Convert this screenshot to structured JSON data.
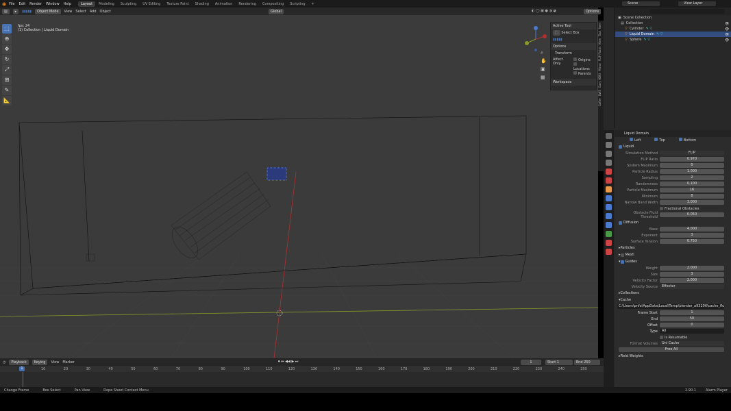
{
  "menu": [
    "File",
    "Edit",
    "Render",
    "Window",
    "Help"
  ],
  "workspaces": [
    "Layout",
    "Modeling",
    "Sculpting",
    "UV Editing",
    "Texture Paint",
    "Shading",
    "Animation",
    "Rendering",
    "Compositing",
    "Scripting",
    "+"
  ],
  "active_workspace": "Layout",
  "scene": "Scene",
  "view_layer": "View Layer",
  "viewport": {
    "mode": "Object Mode",
    "menus": [
      "View",
      "Select",
      "Add",
      "Object"
    ],
    "orientation": "Global",
    "options_label": "Options",
    "fps": "fps: 24",
    "context": "(1) Collection | Liquid Domain"
  },
  "npanel": {
    "active_tool": "Active Tool",
    "select_box": "Select Box",
    "options": "Options",
    "transform": "Transform",
    "affect_only": "Affect Only",
    "origins": "Origins",
    "locations": "Locations",
    "parents": "Parents",
    "workspace": "Workspace"
  },
  "side_tabs": [
    "Item",
    "Tool",
    "View",
    "FLIP Fluids",
    "Mirror",
    "Easy HDRI",
    "BWS",
    "Gaffer",
    "HardOps",
    "MESHmachine"
  ],
  "outliner": {
    "root": "Scene Collection",
    "items": [
      "Collection",
      "Cylinder",
      "Liquid Domain",
      "Sphere"
    ]
  },
  "properties": {
    "object": "Liquid Domain",
    "bounds": [
      "Left",
      "Top",
      "Bottom"
    ],
    "liquid": "Liquid",
    "fields": [
      {
        "label": "Simulation Method",
        "value": "FLIP"
      },
      {
        "label": "FLIP Ratio",
        "value": "0.970"
      },
      {
        "label": "System Maximum",
        "value": "0"
      },
      {
        "label": "Particle Radius",
        "value": "1.000"
      },
      {
        "label": "Sampling",
        "value": "2"
      },
      {
        "label": "Randomness",
        "value": "0.100"
      },
      {
        "label": "Particle Maximum",
        "value": "16"
      },
      {
        "label": "Minimum",
        "value": "8"
      },
      {
        "label": "Narrow Band Width",
        "value": "3.000"
      }
    ],
    "fractional": "Fractional Obstacles",
    "obstacle_dist": {
      "label": "Obstacle Fluid Threshold",
      "value": "0.050"
    },
    "diffusion": "Diffusion",
    "diff_fields": [
      {
        "label": "Base",
        "value": "4.000"
      },
      {
        "label": "Exponent",
        "value": "3"
      },
      {
        "label": "Surface Tension",
        "value": "0.750"
      }
    ],
    "particles": "Particles",
    "mesh": "Mesh",
    "guides": "Guides",
    "guide_fields": [
      {
        "label": "Weight",
        "value": "2.000"
      },
      {
        "label": "Size",
        "value": "3"
      },
      {
        "label": "Velocity Factor",
        "value": "2.000"
      },
      {
        "label": "Velocity Source",
        "value": "Effector"
      }
    ],
    "collections": "Collections",
    "cache": "Cache",
    "cache_path": "C:\\Users\\pnfo\\AppData\\Local\\Temp\\blender_a93206\\cache_fluid_4580f...",
    "frame_start": {
      "label": "Frame Start",
      "value": "1"
    },
    "end": {
      "label": "End",
      "value": "50"
    },
    "offset": {
      "label": "Offset",
      "value": "0"
    },
    "type": {
      "label": "Type",
      "value": "All"
    },
    "resumable": "Is Resumable",
    "format_volumes": {
      "label": "Format Volumes",
      "value": "Uni Cache"
    },
    "free_all": "Free All",
    "field_weights": "Field Weights"
  },
  "timeline": {
    "menus": [
      "Playback",
      "Keying",
      "View",
      "Marker"
    ],
    "current_frame": "1",
    "start_label": "Start",
    "start": "1",
    "end_label": "End",
    "end": "250",
    "ticks": [
      "10",
      "20",
      "30",
      "40",
      "50",
      "60",
      "70",
      "80",
      "90",
      "100",
      "110",
      "120",
      "130",
      "140",
      "150",
      "160",
      "170",
      "180",
      "190",
      "200",
      "210",
      "220",
      "230",
      "240",
      "250"
    ],
    "playhead": "1"
  },
  "status": {
    "items": [
      "Change Frame",
      "Box Select",
      "Pan View",
      "Dope Sheet Context Menu"
    ],
    "version": "2.90.1",
    "player": "Alarm Player"
  }
}
